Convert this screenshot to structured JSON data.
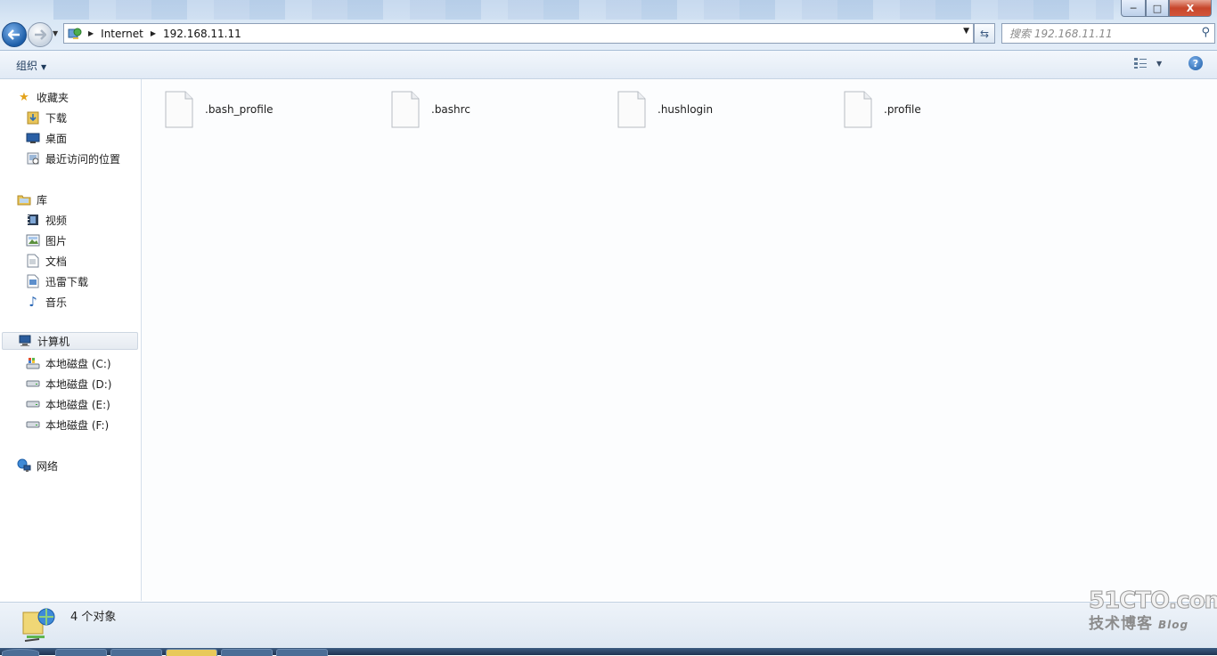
{
  "window": {
    "min_label": "─",
    "max_label": "□",
    "close_label": "X"
  },
  "address": {
    "breadcrumbs": [
      "Internet",
      "192.168.11.11"
    ]
  },
  "search": {
    "placeholder": "搜索 192.168.11.11"
  },
  "toolbar": {
    "organize_label": "组织"
  },
  "help": {
    "label": "?"
  },
  "sidebar": {
    "favorites": {
      "label": "收藏夹",
      "icon": "star-icon",
      "items": [
        {
          "label": "下载",
          "icon": "download-folder-icon"
        },
        {
          "label": "桌面",
          "icon": "desktop-icon"
        },
        {
          "label": "最近访问的位置",
          "icon": "recent-places-icon"
        }
      ]
    },
    "libraries": {
      "label": "库",
      "icon": "library-icon",
      "items": [
        {
          "label": "视频",
          "icon": "video-icon"
        },
        {
          "label": "图片",
          "icon": "picture-icon"
        },
        {
          "label": "文档",
          "icon": "document-icon"
        },
        {
          "label": "迅雷下载",
          "icon": "thunder-download-icon"
        },
        {
          "label": "音乐",
          "icon": "music-icon"
        }
      ]
    },
    "computer": {
      "label": "计算机",
      "icon": "computer-icon",
      "items": [
        {
          "label": "本地磁盘 (C:)",
          "icon": "system-drive-icon"
        },
        {
          "label": "本地磁盘 (D:)",
          "icon": "drive-icon"
        },
        {
          "label": "本地磁盘 (E:)",
          "icon": "drive-icon"
        },
        {
          "label": "本地磁盘 (F:)",
          "icon": "drive-icon"
        }
      ]
    },
    "network": {
      "label": "网络",
      "icon": "network-icon"
    }
  },
  "files": [
    {
      "name": ".bash_profile",
      "icon": "file-icon"
    },
    {
      "name": ".bashrc",
      "icon": "file-icon"
    },
    {
      "name": ".hushlogin",
      "icon": "file-icon"
    },
    {
      "name": ".profile",
      "icon": "file-icon"
    }
  ],
  "status": {
    "count_text": "4 个对象",
    "icon": "network-location-icon"
  },
  "watermark": {
    "line1": "51CTO.com",
    "line2": "技术博客",
    "line2_suffix": "Blog"
  },
  "colors": {
    "accent": "#1d5ea8",
    "close": "#c7462b"
  }
}
